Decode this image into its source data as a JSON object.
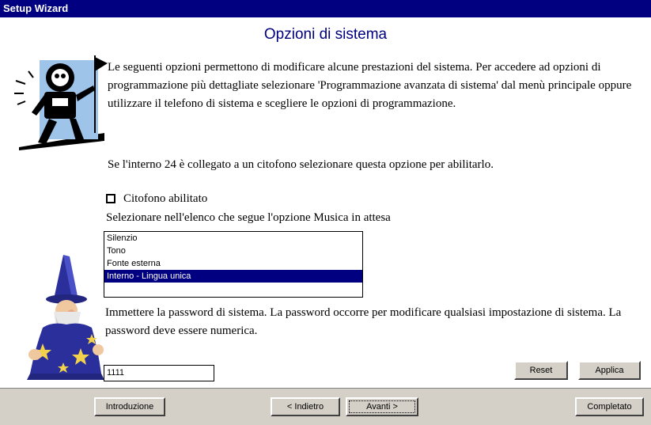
{
  "window": {
    "title": "Setup Wizard"
  },
  "page": {
    "heading": "Opzioni di sistema",
    "intro": "Le seguenti opzioni permettono di modificare alcune prestazioni del sistema. Per accedere ad opzioni di programmazione più dettagliate selezionare 'Programmazione avanzata di sistema' dal menù principale oppure utilizzare il telefono di sistema e scegliere le opzioni di programmazione.",
    "intercom_note": "Se l'interno 24 è collegato a un citofono selezionare questa opzione per abilitarlo.",
    "intercom_checkbox": {
      "label": "Citofono abilitato",
      "checked": false
    },
    "music_label": "Selezionare nell'elenco che segue l'opzione Musica in attesa",
    "music_options": [
      "Silenzio",
      "Tono",
      "Fonte esterna",
      "Interno - Lingua unica"
    ],
    "music_selected_index": 3,
    "password_note": "Immettere la password di sistema.  La password occorre per modificare qualsiasi impostazione di sistema. La password deve essere numerica.",
    "password_value": "1111"
  },
  "buttons": {
    "reset": "Reset",
    "apply": "Applica",
    "intro": "Introduzione",
    "back": "< Indietro",
    "next": "Avanti >",
    "finish": "Completato"
  },
  "colors": {
    "title_bar": "#000080",
    "heading": "#000080",
    "selection": "#000080",
    "button_face": "#d4d0c8"
  },
  "icons": {
    "astronaut": "astronaut-flag-icon",
    "wizard": "wizard-character-icon"
  }
}
